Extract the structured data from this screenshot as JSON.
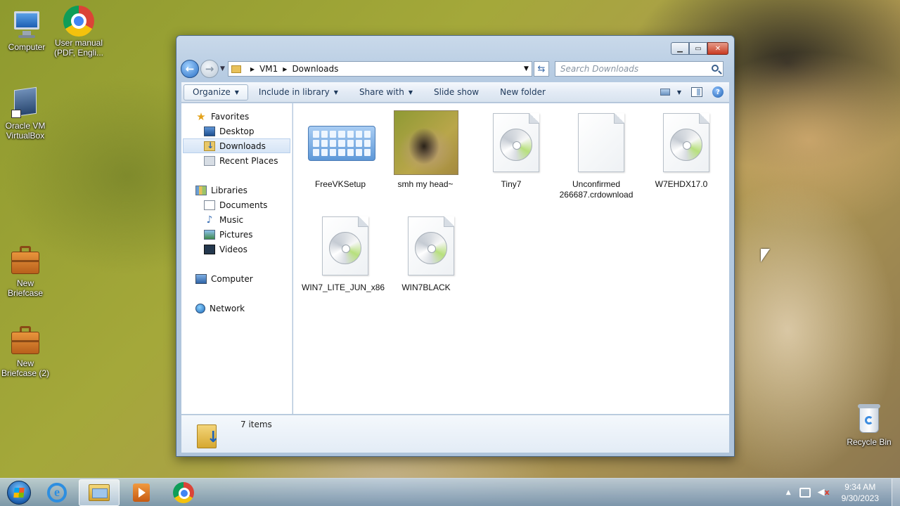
{
  "desktop": {
    "icons": [
      {
        "label": "Computer"
      },
      {
        "label": "User manual (PDF, Engli..."
      },
      {
        "label": "Oracle VM VirtualBox"
      },
      {
        "label": "New Briefcase"
      },
      {
        "label": "New Briefcase (2)"
      },
      {
        "label": "Recycle Bin"
      }
    ]
  },
  "window": {
    "address": {
      "root": "VM1",
      "current": "Downloads"
    },
    "search_placeholder": "Search Downloads",
    "toolbar": {
      "organize": "Organize",
      "include_in_library": "Include in library",
      "share_with": "Share with",
      "slide_show": "Slide show",
      "new_folder": "New folder"
    },
    "nav": {
      "favorites": "Favorites",
      "desktop": "Desktop",
      "downloads": "Downloads",
      "recent_places": "Recent Places",
      "libraries": "Libraries",
      "documents": "Documents",
      "music": "Music",
      "pictures": "Pictures",
      "videos": "Videos",
      "computer": "Computer",
      "network": "Network"
    },
    "files": [
      {
        "name": "FreeVKSetup",
        "icon": "keyboard-icon"
      },
      {
        "name": "smh my head~",
        "icon": "image-thumbnail"
      },
      {
        "name": "Tiny7",
        "icon": "disc-image-icon"
      },
      {
        "name": "Unconfirmed 266687.crdownload",
        "icon": "blank-file-icon"
      },
      {
        "name": "W7EHDX17.0",
        "icon": "disc-image-icon"
      },
      {
        "name": "WIN7_LITE_JUN_x86",
        "icon": "disc-image-icon"
      },
      {
        "name": "WIN7BLACK",
        "icon": "disc-image-icon"
      }
    ],
    "status": {
      "item_count": "7 items"
    }
  },
  "taskbar": {
    "clock_time": "9:34 AM",
    "clock_date": "9/30/2023"
  }
}
